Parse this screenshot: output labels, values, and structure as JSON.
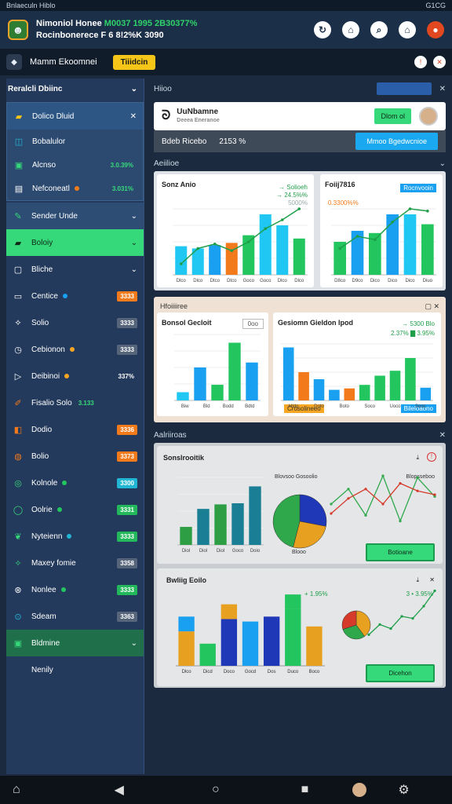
{
  "statusbar": {
    "left": "Bnlaeculn Hiblo",
    "right": "G1CG"
  },
  "appbar": {
    "line1": "Nimoniol Honee",
    "line1_extra": "M0037 1995 2B30377%",
    "line2": "Rocinbonerece F 6 8!2%K 3090",
    "icons": [
      "refresh-icon",
      "lock-icon",
      "search-icon",
      "home-icon",
      "profile-icon"
    ]
  },
  "toolbar": {
    "title": "Mamm Ekoomnei",
    "chip": "Tiiidcin"
  },
  "sidebar": {
    "header": "Reralcli Dbiinc",
    "groups": [
      {
        "label": "Dolico Dluid",
        "icon": "folder-icon"
      },
      {
        "label": "Bobalulor",
        "icon": "grid-icon"
      },
      {
        "label": "Alcnso",
        "icon": "image-icon",
        "tag": "3.0.39%"
      },
      {
        "label": "Nefconeatl",
        "icon": "list-icon",
        "tag": "3.031%"
      }
    ],
    "items": [
      {
        "label": "Sender Unde",
        "icon": "pen-icon"
      },
      {
        "label": "Boloiy",
        "icon": "cart-icon"
      },
      {
        "label": "Bliche",
        "icon": "doc-icon"
      },
      {
        "label": "Centice",
        "icon": "mail-icon",
        "tag": "3333"
      },
      {
        "label": "Solio",
        "icon": "rocket-icon",
        "tag": "3333"
      },
      {
        "label": "Cebionon",
        "icon": "clock-icon",
        "tag": "3333"
      },
      {
        "label": "Deibinoi",
        "icon": "play-icon",
        "tag": "337%"
      },
      {
        "label": "Fisalio Solo",
        "icon": "brush-icon",
        "tag": "3.133"
      },
      {
        "label": "Dodio",
        "icon": "bag-icon",
        "tag": "3336"
      },
      {
        "label": "Bolio",
        "icon": "coin-icon",
        "tag": "3373"
      },
      {
        "label": "Kolnole",
        "icon": "chat-icon",
        "tag": "3300"
      },
      {
        "label": "Oolrie",
        "icon": "ring-icon",
        "tag": "3331"
      },
      {
        "label": "Nyteienn",
        "icon": "leaf-icon",
        "tag": "3333"
      },
      {
        "label": "Maxey fomie",
        "icon": "spark-icon",
        "tag": "3358"
      },
      {
        "label": "Nonlee",
        "icon": "map-icon",
        "tag": "3333"
      },
      {
        "label": "Sdeam",
        "icon": "target-icon",
        "tag": "3363"
      },
      {
        "label": "Bldmine",
        "icon": "box-icon"
      },
      {
        "label": "Nenily",
        "icon": ""
      }
    ]
  },
  "main": {
    "header": "Hiioo",
    "profile": {
      "name": "UuNbamne",
      "sub": "Deeea Eneranoe",
      "button": "Dlom ol"
    },
    "strip": {
      "left": "Bdeb Ricebo",
      "mid": "2153 %",
      "button": "Mmoo Bgedwcnioe"
    },
    "section1": "Aeiilioe",
    "card1": {
      "title": "Sonz Anio",
      "legend": [
        "→ Solioeh",
        "→ 24.5%%"
      ],
      "note": "5000%"
    },
    "card2": {
      "title": "Foiij7816",
      "legend": "0.3300%%",
      "chip": "Rocnvooin"
    },
    "section2": "Hfoiiiiree",
    "card3": {
      "title": "Bonsol Gecloit",
      "input": "0oo"
    },
    "card4": {
      "title": "Gesiomn Gieldon Ipod",
      "legend1": "→ 5300 Blo",
      "legend2": "2.37% ▇ 3.95%",
      "chip_a": "Crosolineeo",
      "chip_b": "Bileloaono"
    },
    "section3": "Aalriiroas",
    "card5": {
      "title": "Sonslrooitik",
      "legend_left": "Blovsoo Gosoolio",
      "legend_right": "Blopsseboo",
      "pie_label": "Blooo",
      "button": "Botioane"
    },
    "card6": {
      "title": "Bwliig Eoilo",
      "legend_left": "+ 1.95%",
      "legend_right": "3 • 3.95%",
      "button": "Dicehon"
    }
  },
  "chart_data": [
    {
      "type": "bar",
      "title": "Sonz Anio",
      "categories": [
        "Dlco",
        "Dlco",
        "Dtco",
        "Dtco",
        "Goco",
        "Goco",
        "Dlco",
        "Dlco"
      ],
      "values": [
        26,
        24,
        27,
        29,
        36,
        55,
        45,
        33
      ],
      "colors": [
        "#1fc7f2",
        "#1fc7f2",
        "#1aa0f0",
        "#f27a1a",
        "#22c55e",
        "#1fc7f2",
        "#1fc7f2",
        "#22c55e"
      ],
      "line": [
        10,
        24,
        28,
        22,
        30,
        42,
        50,
        60
      ],
      "ylim": [
        0,
        60
      ],
      "yticks": [
        "100",
        "50",
        "30",
        "100",
        "100"
      ]
    },
    {
      "type": "bar",
      "title": "Foiij7816",
      "categories": [
        "D8co",
        "D9co",
        "Dico",
        "Dico",
        "Dico",
        "Diuo"
      ],
      "values": [
        30,
        40,
        38,
        55,
        55,
        46
      ],
      "colors": [
        "#22c55e",
        "#1aa0f0",
        "#22c55e",
        "#1aa0f0",
        "#1fc7f2",
        "#22c55e"
      ],
      "line": [
        24,
        35,
        32,
        48,
        60,
        58
      ],
      "ylim": [
        0,
        60
      ]
    },
    {
      "type": "bar",
      "title": "Bonsol Gecloit",
      "categories": [
        "Biw",
        "Bld",
        "Bodd",
        "Bdtd"
      ],
      "values": [
        10,
        40,
        19,
        70,
        46
      ],
      "colors": [
        "#1fc7f2",
        "#1aa0f0",
        "#22c55e",
        "#22c55e",
        "#1aa0f0"
      ],
      "ylim": [
        0,
        80
      ]
    },
    {
      "type": "bar",
      "title": "Gesiomn Gieldon Ipod",
      "categories": [
        "Hldo",
        "Doto",
        "Boto",
        "Soco",
        "Uoco",
        "Sooc"
      ],
      "values": [
        75,
        40,
        30,
        15,
        17,
        22,
        35,
        42,
        60,
        18
      ],
      "colors": [
        "#1aa0f0",
        "#f27a1a",
        "#1aa0f0",
        "#1aa0f0",
        "#f27a1a",
        "#22c55e",
        "#22c55e",
        "#22c55e",
        "#22c55e",
        "#1aa0f0"
      ],
      "ylim": [
        0,
        80
      ]
    },
    {
      "type": "bar",
      "title": "Sonslrooitik",
      "categories": [
        "Diol",
        "Diol",
        "Diol",
        "Goco",
        "Doio"
      ],
      "values": [
        16,
        32,
        36,
        37,
        52
      ],
      "colors": [
        "#2e9e44",
        "#1a7f94",
        "#2e9e44",
        "#1a7f94",
        "#1a7f94"
      ],
      "ylim": [
        0,
        60
      ],
      "pie": [
        0.28,
        0.26,
        0.46
      ],
      "pie_colors": [
        "#1e38b8",
        "#e8a020",
        "#2ea84a"
      ],
      "lines": [
        [
          30,
          46,
          18,
          60,
          12,
          58,
          38
        ],
        [
          20,
          36,
          46,
          30,
          52,
          44,
          40
        ]
      ]
    },
    {
      "type": "bar",
      "title": "Bwliig Eoilo",
      "categories": [
        "Dlco",
        "Dicd",
        "Doco",
        "Gocd",
        "Dos",
        "Duco",
        "Boco"
      ],
      "values": [
        [
          28,
          12
        ],
        [
          18
        ],
        [
          38,
          12
        ],
        [
          36
        ],
        [
          40
        ],
        [
          46,
          12
        ],
        [
          32
        ]
      ],
      "colors": [
        "#e8a020",
        "#1aa0f0",
        "#22c55e",
        "#1e38b8",
        "#e8a020",
        "#1aa0f0",
        "#1e38b8",
        "#22c55e",
        "#22c55e"
      ],
      "ylim": [
        0,
        60
      ],
      "pie": [
        0.4,
        0.3,
        0.3
      ],
      "pie_colors": [
        "#e8a020",
        "#2ea84a",
        "#d63a2a"
      ],
      "line": [
        12,
        22,
        18,
        30,
        28,
        40,
        55
      ]
    }
  ]
}
